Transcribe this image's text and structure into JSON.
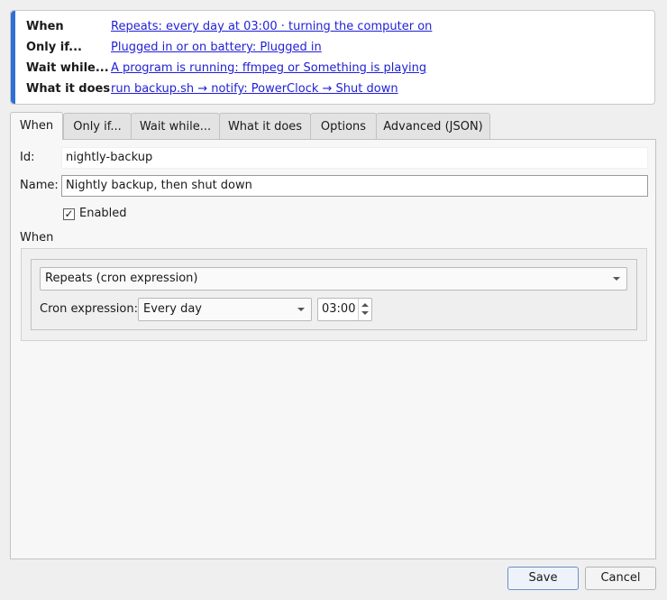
{
  "summary": {
    "rows": [
      {
        "key": "When",
        "value": "Repeats: every day at 03:00 · turning the computer on"
      },
      {
        "key": "Only if...",
        "value": "Plugged in or on battery: Plugged in"
      },
      {
        "key": "Wait while...",
        "value": "A program is running: ffmpeg or Something is playing"
      },
      {
        "key": "What it does",
        "value": "run backup.sh → notify: PowerClock → Shut down"
      }
    ]
  },
  "tabs": [
    "When",
    "Only if...",
    "Wait while...",
    "What it does",
    "Options",
    "Advanced (JSON)"
  ],
  "active_tab": "When",
  "form": {
    "id_label": "Id:",
    "id_value": "nightly-backup",
    "name_label": "Name:",
    "name_value": "Nightly backup, then shut down",
    "enabled_label": "Enabled",
    "enabled_checked": true,
    "check_mark": "✓",
    "section_title": "When",
    "trigger_type": "Repeats (cron expression)",
    "cron_label": "Cron expression:",
    "cron_preset": "Every day",
    "cron_time": "03:00"
  },
  "footer": {
    "save_label": "Save",
    "cancel_label": "Cancel"
  },
  "colors": {
    "accent": "#2f6fd6",
    "link": "#1f1fd6"
  }
}
